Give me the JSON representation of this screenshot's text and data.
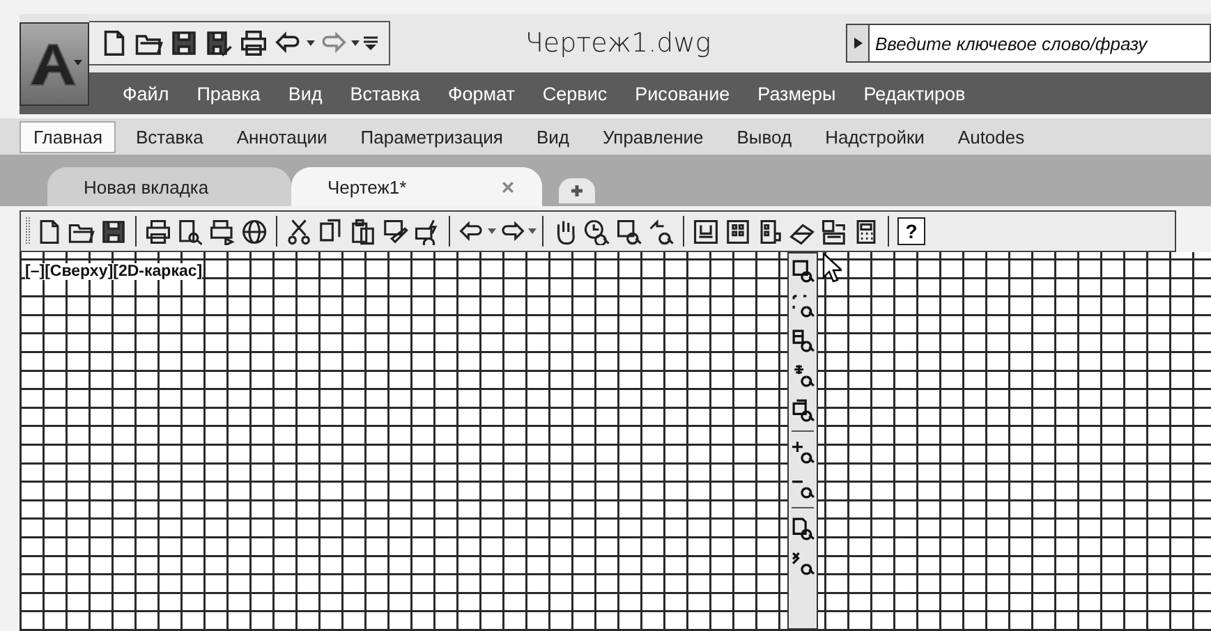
{
  "window": {
    "title": "Чертеж1.dwg"
  },
  "search": {
    "placeholder": "Введите ключевое слово/фразу"
  },
  "menu": [
    "Файл",
    "Правка",
    "Вид",
    "Вставка",
    "Формат",
    "Сервис",
    "Рисование",
    "Размеры",
    "Редактиров"
  ],
  "ribbon_tabs": [
    {
      "label": "Главная",
      "selected": true
    },
    {
      "label": "Вставка",
      "selected": false
    },
    {
      "label": "Аннотации",
      "selected": false
    },
    {
      "label": "Параметризация",
      "selected": false
    },
    {
      "label": "Вид",
      "selected": false
    },
    {
      "label": "Управление",
      "selected": false
    },
    {
      "label": "Вывод",
      "selected": false
    },
    {
      "label": "Надстройки",
      "selected": false
    },
    {
      "label": "Autodes",
      "selected": false
    }
  ],
  "file_tabs": [
    {
      "label": "Новая вкладка",
      "selected": false
    },
    {
      "label": "Чертеж1*",
      "selected": true
    }
  ],
  "toolbar": {
    "help_button": "?"
  },
  "viewport_controls": [
    "[–]",
    "[Сверху]",
    "[2D-каркас]"
  ]
}
